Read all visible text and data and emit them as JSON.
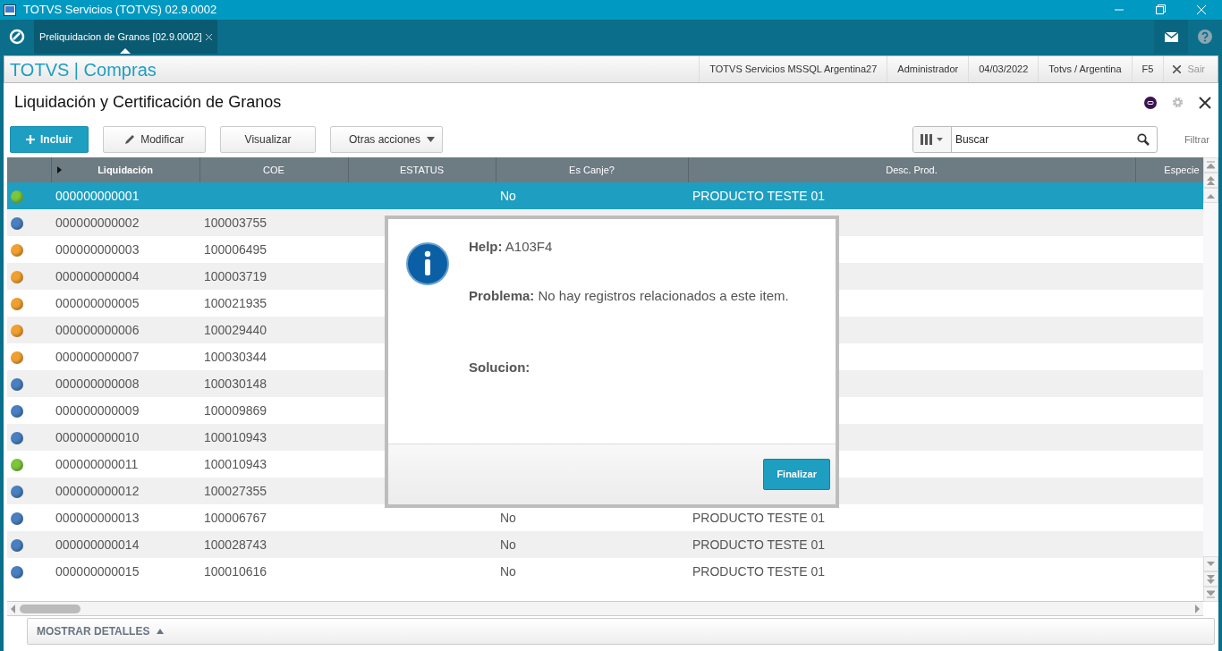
{
  "window": {
    "title": "TOTVS Servicios (TOTVS) 02.9.0002"
  },
  "tabs": [
    {
      "label": "Preliquidacion de Granos [02.9.0002]",
      "selected": true
    }
  ],
  "app_header": {
    "brand": "TOTVS | Compras",
    "info": [
      "TOTVS Servicios MSSQL Argentina27",
      "Administrador",
      "04/03/2022",
      "Totvs / Argentina",
      "F5"
    ],
    "exit": "Sair"
  },
  "page": {
    "title": "Liquidación y Certificación de Granos"
  },
  "toolbar": {
    "buttons": [
      {
        "label": "Incluir",
        "kind": "primary"
      },
      {
        "label": "Modificar",
        "kind": "edit"
      },
      {
        "label": "Visualizar",
        "kind": "plain"
      },
      {
        "label": "Otras acciones",
        "kind": "dropdown"
      }
    ],
    "search": {
      "placeholder": "Buscar"
    },
    "filter": "Filtrar"
  },
  "grid": {
    "columns": [
      "Liquidación",
      "COE",
      "ESTATUS",
      "Es Canje?",
      "Desc. Prod.",
      "Especie"
    ],
    "rows": [
      {
        "color": "#7cc63a",
        "liquidacion": "000000000001",
        "coe": "",
        "es_canje": "No",
        "desc": "PRODUCTO TESTE 01",
        "selected": true
      },
      {
        "color": "#4a7fc0",
        "liquidacion": "000000000002",
        "coe": "100003755",
        "selected": false
      },
      {
        "color": "#f0a030",
        "liquidacion": "000000000003",
        "coe": "100006495",
        "selected": false
      },
      {
        "color": "#f0a030",
        "liquidacion": "000000000004",
        "coe": "100003719",
        "selected": false
      },
      {
        "color": "#f0a030",
        "liquidacion": "000000000005",
        "coe": "100021935",
        "selected": false
      },
      {
        "color": "#f0a030",
        "liquidacion": "000000000006",
        "coe": "100029440",
        "selected": false
      },
      {
        "color": "#f0a030",
        "liquidacion": "000000000007",
        "coe": "100030344",
        "selected": false
      },
      {
        "color": "#4a7fc0",
        "liquidacion": "000000000008",
        "coe": "100030148",
        "selected": false
      },
      {
        "color": "#4a7fc0",
        "liquidacion": "000000000009",
        "coe": "100009869",
        "selected": false
      },
      {
        "color": "#4a7fc0",
        "liquidacion": "000000000010",
        "coe": "100010943",
        "selected": false
      },
      {
        "color": "#7cc63a",
        "liquidacion": "000000000011",
        "coe": "100010943",
        "selected": false
      },
      {
        "color": "#4a7fc0",
        "liquidacion": "000000000012",
        "coe": "100027355",
        "selected": false
      },
      {
        "color": "#4a7fc0",
        "liquidacion": "000000000013",
        "coe": "100006767",
        "es_canje": "No",
        "desc": "PRODUCTO TESTE 01",
        "selected": false
      },
      {
        "color": "#4a7fc0",
        "liquidacion": "000000000014",
        "coe": "100028743",
        "es_canje": "No",
        "desc": "PRODUCTO TESTE 01",
        "selected": false
      },
      {
        "color": "#4a7fc0",
        "liquidacion": "000000000015",
        "coe": "100010616",
        "es_canje": "No",
        "desc": "PRODUCTO TESTE 01",
        "selected": false
      }
    ]
  },
  "dialog": {
    "help": "**Help:** A103F4",
    "problem": "**Problema:** No hay registros relacionados a este item.",
    "solution_label": "Solucion:",
    "button": "Finalizar"
  },
  "footer": {
    "details_toggle": "MOSTRAR DETALLES"
  }
}
